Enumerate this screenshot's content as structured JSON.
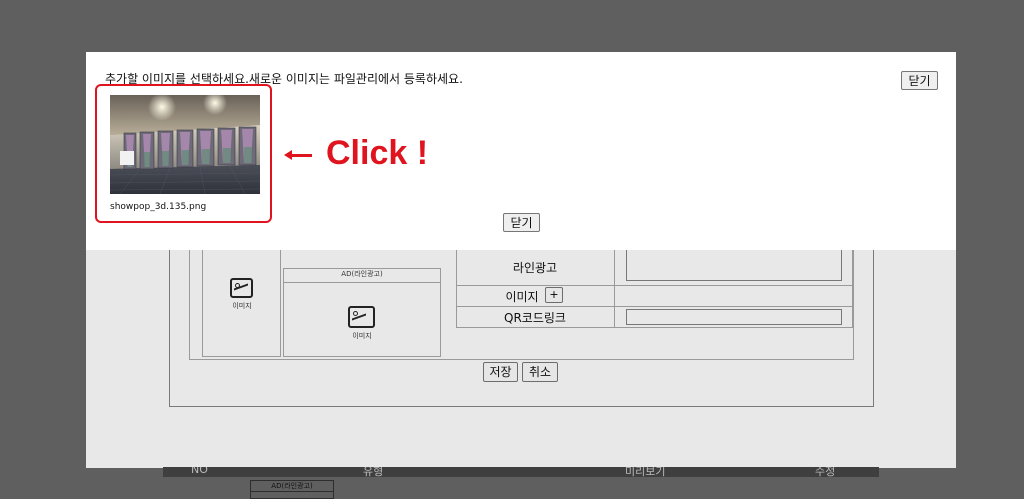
{
  "modal": {
    "message": "추가할 이미지를 선택하세요.새로운 이미지는 파일관리에서 등록하세요.",
    "close_label_top": "닫기",
    "close_label_bottom": "닫기",
    "image": {
      "filename": "showpop_3d.135.png"
    },
    "hint": {
      "text": "Click !",
      "arrow_icon": "left-arrow-icon"
    }
  },
  "background": {
    "ad_line_header": "AD(라인광고)",
    "image_label_1": "이미지",
    "image_label_2": "이미지",
    "rows": {
      "line_ad": "라인광고",
      "image": "이미지",
      "image_add": "+",
      "qr_link": "QR코드링크"
    },
    "save_label": "저장",
    "cancel_label": "취소",
    "table_header": {
      "no": "NO",
      "type": "유형",
      "preview": "미리보기",
      "edit": "수정"
    },
    "bottom_ad_header": "AD(라인광고)"
  },
  "colors": {
    "accent": "#e0141e",
    "overlay": "#5f5f5f",
    "modal_bg": "#ffffff"
  }
}
